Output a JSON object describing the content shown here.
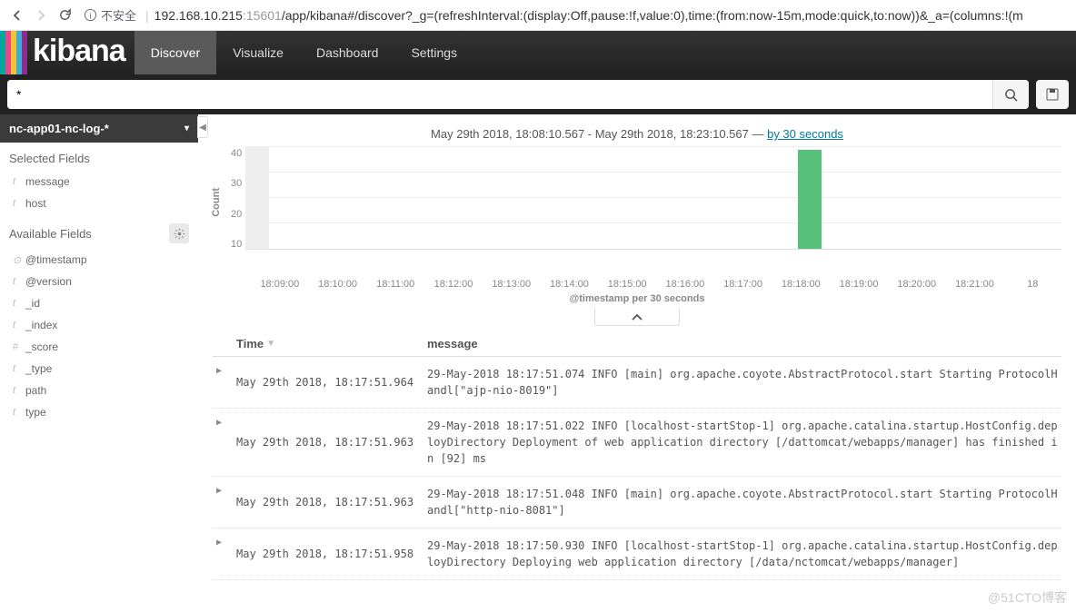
{
  "browser": {
    "insecure_label": "不安全",
    "url_host": "192.168.10.215",
    "url_port": ":15601",
    "url_path": "/app/kibana#/discover?_g=(refreshInterval:(display:Off,pause:!f,value:0),time:(from:now-15m,mode:quick,to:now))&_a=(columns:!(m"
  },
  "nav": {
    "logo": "kibana",
    "tabs": [
      "Discover",
      "Visualize",
      "Dashboard",
      "Settings"
    ],
    "active": 0
  },
  "search": {
    "query": "*"
  },
  "sidebar": {
    "index_pattern": "nc-app01-nc-log-*",
    "selected_fields_label": "Selected Fields",
    "selected_fields": [
      {
        "type": "t",
        "name": "message"
      },
      {
        "type": "t",
        "name": "host"
      }
    ],
    "available_fields_label": "Available Fields",
    "available_fields": [
      {
        "type": "⊙",
        "name": "@timestamp"
      },
      {
        "type": "t",
        "name": "@version"
      },
      {
        "type": "t",
        "name": "_id"
      },
      {
        "type": "t",
        "name": "_index"
      },
      {
        "type": "#",
        "name": "_score"
      },
      {
        "type": "t",
        "name": "_type"
      },
      {
        "type": "t",
        "name": "path"
      },
      {
        "type": "t",
        "name": "type"
      }
    ]
  },
  "time_range": {
    "text": "May 29th 2018, 18:08:10.567 - May 29th 2018, 18:23:10.567 — ",
    "interval_link": "by 30 seconds"
  },
  "chart_data": {
    "type": "bar",
    "title": "",
    "xlabel": "@timestamp per 30 seconds",
    "ylabel": "Count",
    "ylim": [
      0,
      40
    ],
    "y_ticks": [
      40,
      30,
      20,
      10
    ],
    "x_ticks": [
      "18:09:00",
      "18:10:00",
      "18:11:00",
      "18:12:00",
      "18:13:00",
      "18:14:00",
      "18:15:00",
      "18:16:00",
      "18:17:00",
      "18:18:00",
      "18:19:00",
      "18:20:00",
      "18:21:00",
      "18"
    ],
    "bars": [
      {
        "x_index": 0.0,
        "value": 40,
        "ghost": true
      },
      {
        "x_index": 8.8,
        "value": 39,
        "ghost": false
      }
    ]
  },
  "table": {
    "columns": {
      "time": "Time",
      "message": "message"
    },
    "rows": [
      {
        "time": "May 29th 2018, 18:17:51.964",
        "message": "29-May-2018 18:17:51.074 INFO [main] org.apache.coyote.AbstractProtocol.start Starting ProtocolHandl[\"ajp-nio-8019\"]"
      },
      {
        "time": "May 29th 2018, 18:17:51.963",
        "message": "29-May-2018 18:17:51.022 INFO [localhost-startStop-1] org.apache.catalina.startup.HostConfig.deployDirectory Deployment of web application directory [/dattomcat/webapps/manager] has finished in [92] ms"
      },
      {
        "time": "May 29th 2018, 18:17:51.963",
        "message": "29-May-2018 18:17:51.048 INFO [main] org.apache.coyote.AbstractProtocol.start Starting ProtocolHandl[\"http-nio-8081\"]"
      },
      {
        "time": "May 29th 2018, 18:17:51.958",
        "message": "29-May-2018 18:17:50.930 INFO [localhost-startStop-1] org.apache.catalina.startup.HostConfig.deployDirectory Deploying web application directory [/data/nctomcat/webapps/manager]"
      }
    ]
  },
  "colors": {
    "stripes": [
      "#00a69b",
      "#e8478b",
      "#f4c430",
      "#3caed2",
      "#8b2e8b"
    ],
    "bar_green": "#57c17b"
  },
  "watermark": "@51CTO博客"
}
